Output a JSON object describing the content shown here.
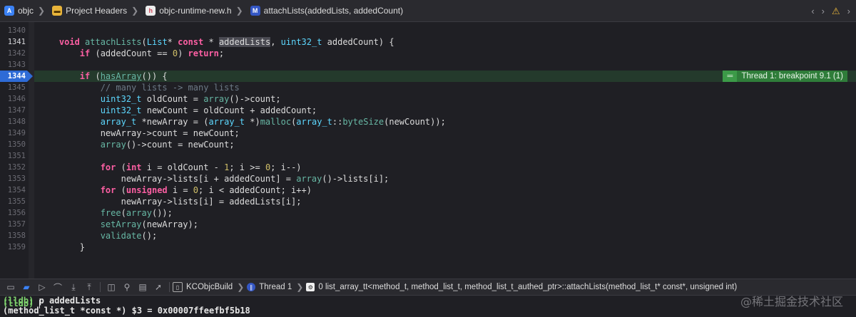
{
  "breadcrumbs": [
    {
      "label": "objc",
      "icon": "xcode-project-icon",
      "color": "#3b82f6"
    },
    {
      "label": "Project Headers",
      "icon": "folder-icon",
      "color": "#e8b43a"
    },
    {
      "label": "objc-runtime-new.h",
      "icon": "header-file-icon",
      "color": "#d1495b"
    },
    {
      "label": "attachLists(addedLists, addedCount)",
      "icon": "method-icon",
      "color": "#3457c5"
    }
  ],
  "nav": {
    "back": "‹",
    "forward": "›",
    "warning_icon": "warning-icon"
  },
  "editor": {
    "breakpoint_badge": "Thread 1: breakpoint 9.1 (1)",
    "lines": [
      {
        "n": "1340",
        "code": ""
      },
      {
        "n": "1341",
        "code": "    void attachLists(List* const * addedLists, uint32_t addedCount) {"
      },
      {
        "n": "1342",
        "code": "        if (addedCount == 0) return;"
      },
      {
        "n": "1343",
        "code": ""
      },
      {
        "n": "1344",
        "code": "        if (hasArray()) {"
      },
      {
        "n": "1345",
        "code": "            // many lists -> many lists"
      },
      {
        "n": "1346",
        "code": "            uint32_t oldCount = array()->count;"
      },
      {
        "n": "1347",
        "code": "            uint32_t newCount = oldCount + addedCount;"
      },
      {
        "n": "1348",
        "code": "            array_t *newArray = (array_t *)malloc(array_t::byteSize(newCount));"
      },
      {
        "n": "1349",
        "code": "            newArray->count = newCount;"
      },
      {
        "n": "1350",
        "code": "            array()->count = newCount;"
      },
      {
        "n": "1351",
        "code": ""
      },
      {
        "n": "1352",
        "code": "            for (int i = oldCount - 1; i >= 0; i--)"
      },
      {
        "n": "1353",
        "code": "                newArray->lists[i + addedCount] = array()->lists[i];"
      },
      {
        "n": "1354",
        "code": "            for (unsigned i = 0; i < addedCount; i++)"
      },
      {
        "n": "1355",
        "code": "                newArray->lists[i] = addedLists[i];"
      },
      {
        "n": "1356",
        "code": "            free(array());"
      },
      {
        "n": "1357",
        "code": "            setArray(newArray);"
      },
      {
        "n": "1358",
        "code": "            validate();"
      },
      {
        "n": "1359",
        "code": "        }"
      }
    ]
  },
  "debug_bar": {
    "target": "KCObjcBuild",
    "thread": "Thread 1",
    "frame": "0 list_array_tt<method_t, method_list_t, method_list_t_authed_ptr>::attachLists(method_list_t* const*, unsigned int)"
  },
  "console": {
    "lines": [
      {
        "prompt": "(lldb)",
        "text": " p addedLists"
      },
      {
        "prompt": "",
        "text": "(method_list_t *const *) $3 = 0x00007ffeefbf5b18"
      },
      {
        "prompt": "(lldb)",
        "text": " "
      }
    ]
  },
  "watermark": "@稀土掘金技术社区"
}
